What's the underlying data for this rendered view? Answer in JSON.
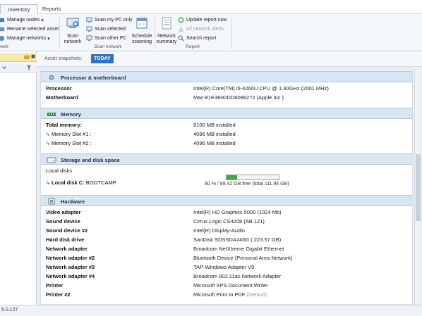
{
  "tabs": {
    "inventory": "Inventory",
    "reports": "Reports"
  },
  "ribbon": {
    "manage_nodes": "Manage nodes",
    "rename_asset": "Rename selected asset",
    "manage_networks": "Manage networks",
    "left_group_label": "work",
    "scan_network": "Scan\nnetwork",
    "scan_my_pc": "Scan my PC only",
    "scan_selected": "Scan selected",
    "scan_other_pc": "Scan other PC",
    "schedule_scanning": "Schedule\nscanning",
    "scan_group_label": "Scan network",
    "network_summary": "Network\nsummary",
    "update_report": "Update report now",
    "all_network_alerts": "All network alerts",
    "search_report": "Search report",
    "report_group_label": "Report"
  },
  "snapshots": {
    "label": "Asset snapshots:",
    "today": "TODAY"
  },
  "sections": {
    "processor": {
      "title": "Processor & motherboard",
      "rows": [
        {
          "key": "Processor",
          "value": "Intel(R) Core(TM) i5-4260U CPU @ 1.40GHz (2001 MHz)"
        },
        {
          "key": "Motherboard",
          "value": "Mac-81E3E92DD6088272 (Apple Inc.)"
        }
      ]
    },
    "memory": {
      "title": "Memory",
      "total_key": "Total memory:",
      "total_value": "8100 MB installed",
      "slots": [
        {
          "key": "Memory Slot #1 :",
          "value": "4096 MB installed"
        },
        {
          "key": "Memory Slot #2 :",
          "value": "4096 MB installed"
        }
      ]
    },
    "storage": {
      "title": "Storage and disk space",
      "local_disks": "Local disks",
      "disk_key": "Local disk C:",
      "disk_name": "BOOTCAMP",
      "free_percent": 20,
      "free_caption": "80 % / 89.42 GB free (total 111.94 GB)"
    },
    "hardware": {
      "title": "Hardware",
      "rows": [
        {
          "key": "Video adapter",
          "value": "Intel(R) HD Graphics 5000 (1024 Mb)",
          "default": ""
        },
        {
          "key": "Sound device",
          "value": "Cirrus Logic CS4208 (AB 121)",
          "default": ""
        },
        {
          "key": "Sound device #2",
          "value": "Intel(R) Display-Audio",
          "default": ""
        },
        {
          "key": "Hard disk drive",
          "value": "SanDisk SDSSDA240G ( 223.57 GB)",
          "default": ""
        },
        {
          "key": "Network adapter",
          "value": "Broadcom NetXtreme Gigabit Ethernet",
          "default": ""
        },
        {
          "key": "Network adapter #2",
          "value": "Bluetooth Device (Personal Area Network)",
          "default": ""
        },
        {
          "key": "Network adapter #3",
          "value": "TAP-Windows Adapter V9",
          "default": ""
        },
        {
          "key": "Network adapter #4",
          "value": "Broadcom 802.11ac Network Adapter",
          "default": ""
        },
        {
          "key": "Printer",
          "value": "Microsoft XPS Document Writer",
          "default": ""
        },
        {
          "key": "Printer #2",
          "value": "Microsoft Print to PDF",
          "default": "(Default)"
        }
      ]
    }
  },
  "status": {
    "version": "5.0.127"
  },
  "colors": {
    "accent": "#2f72c8",
    "section_header": "#d9e6f2",
    "progress": "#3ea83e"
  }
}
